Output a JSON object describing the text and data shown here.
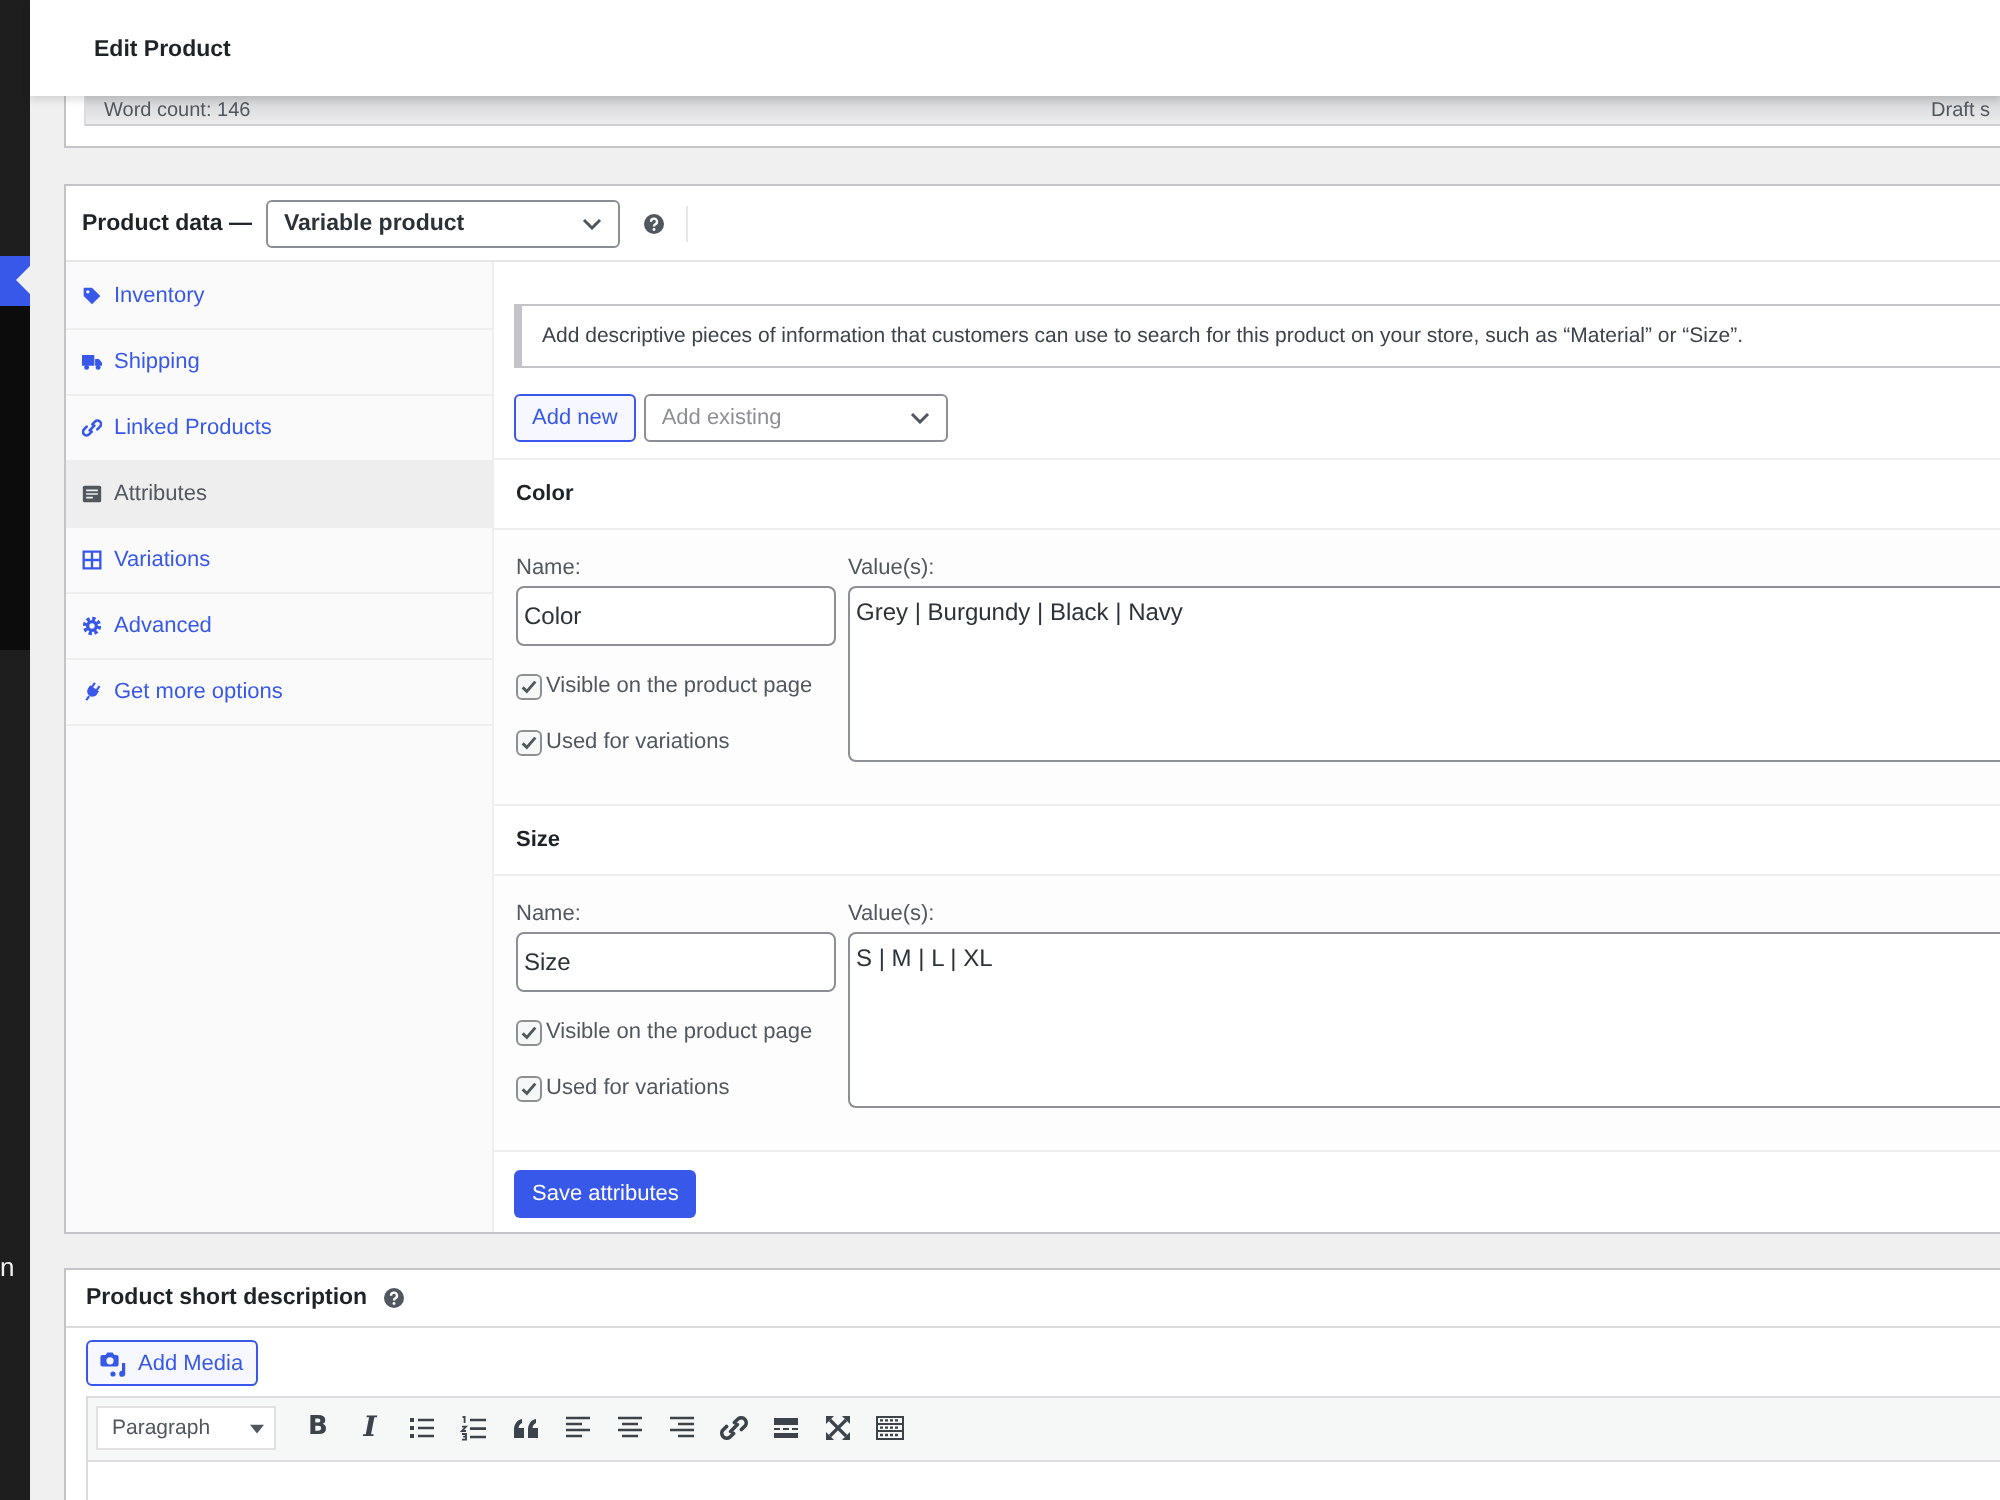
{
  "admin_menu": {
    "visible_text": "n"
  },
  "header": {
    "title": "Edit Product"
  },
  "editor_status": {
    "word_count": "Word count: 146",
    "status": "Draft s"
  },
  "product_data": {
    "label": "Product data —",
    "product_type": {
      "value": "Variable product"
    },
    "tabs": [
      {
        "label": "Inventory",
        "kind": "tag",
        "selected": false
      },
      {
        "label": "Shipping",
        "kind": "truck",
        "selected": false
      },
      {
        "label": "Linked Products",
        "kind": "link",
        "selected": false
      },
      {
        "label": "Attributes",
        "kind": "list",
        "selected": true
      },
      {
        "label": "Variations",
        "kind": "grid",
        "selected": false
      },
      {
        "label": "Advanced",
        "kind": "gear",
        "selected": false
      },
      {
        "label": "Get more options",
        "kind": "plug",
        "selected": false
      }
    ],
    "notice": "Add descriptive pieces of information that customers can use to search for this product on your store, such as “Material” or “Size”.",
    "add_new_button": "Add new",
    "add_existing": {
      "placeholder": "Add existing"
    },
    "attributes": [
      {
        "title": "Color",
        "name_label": "Name:",
        "name": "Color",
        "values_label": "Value(s):",
        "values": "Grey | Burgundy | Black | Navy",
        "options": [
          {
            "label": "Visible on the product page",
            "checked": true
          },
          {
            "label": "Used for variations",
            "checked": true
          }
        ]
      },
      {
        "title": "Size",
        "name_label": "Name:",
        "name": "Size",
        "values_label": "Value(s):",
        "values": "S | M | L | XL",
        "options": [
          {
            "label": "Visible on the product page",
            "checked": true
          },
          {
            "label": "Used for variations",
            "checked": true
          }
        ]
      }
    ],
    "save_button": "Save attributes"
  },
  "short_description": {
    "title": "Product short description",
    "add_media_button": "Add Media",
    "format": {
      "value": "Paragraph"
    },
    "toolbar": [
      {
        "kind": "bold",
        "label": "B"
      },
      {
        "kind": "italic",
        "label": "I"
      },
      {
        "kind": "bullets"
      },
      {
        "kind": "numbers"
      },
      {
        "kind": "quote"
      },
      {
        "kind": "alignleft"
      },
      {
        "kind": "aligncenter"
      },
      {
        "kind": "alignright"
      },
      {
        "kind": "link"
      },
      {
        "kind": "more"
      },
      {
        "kind": "fullscreen"
      },
      {
        "kind": "toolbar"
      }
    ]
  }
}
